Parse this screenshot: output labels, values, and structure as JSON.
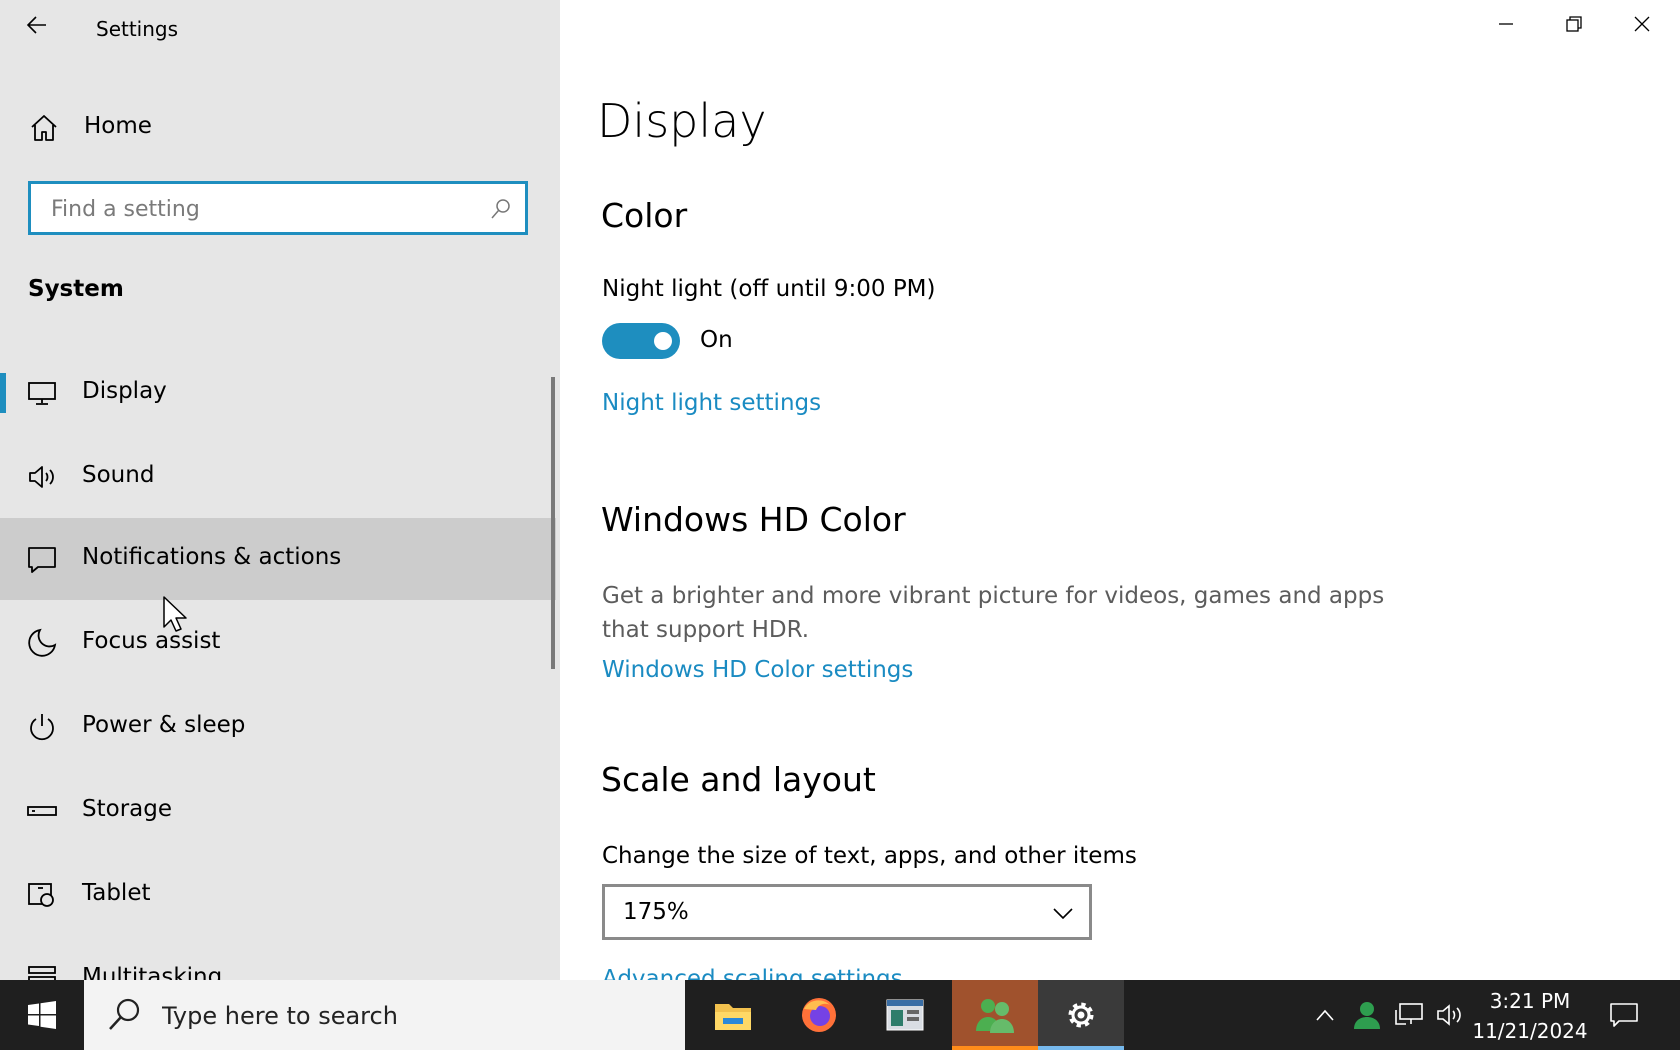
{
  "window": {
    "title": "Settings",
    "minimize_icon": "minimize-icon",
    "restore_icon": "restore-icon",
    "close_icon": "close-icon"
  },
  "sidebar": {
    "home_label": "Home",
    "search_placeholder": "Find a setting",
    "section": "System",
    "items": [
      {
        "label": "Display",
        "icon": "monitor-icon",
        "selected": true
      },
      {
        "label": "Sound",
        "icon": "speaker-icon"
      },
      {
        "label": "Notifications & actions",
        "icon": "notification-icon",
        "hover": true
      },
      {
        "label": "Focus assist",
        "icon": "moon-icon"
      },
      {
        "label": "Power & sleep",
        "icon": "power-icon"
      },
      {
        "label": "Storage",
        "icon": "storage-icon"
      },
      {
        "label": "Tablet",
        "icon": "tablet-icon"
      },
      {
        "label": "Multitasking",
        "icon": "multitasking-icon"
      }
    ]
  },
  "main": {
    "title": "Display",
    "color": {
      "heading": "Color",
      "night_light_label": "Night light (off until 9:00 PM)",
      "toggle_state": "On",
      "toggle_on": true,
      "settings_link": "Night light settings"
    },
    "hd_color": {
      "heading": "Windows HD Color",
      "description": "Get a brighter and more vibrant picture for videos, games and apps that support HDR.",
      "settings_link": "Windows HD Color settings"
    },
    "scale": {
      "heading": "Scale and layout",
      "label": "Change the size of text, apps, and other items",
      "value": "175%",
      "advanced_link": "Advanced scaling settings"
    }
  },
  "taskbar": {
    "search_placeholder": "Type here to search",
    "apps": [
      "file-explorer-icon",
      "firefox-icon",
      "app-window-icon",
      "people-app-icon",
      "settings-gear-icon"
    ],
    "time": "3:21 PM",
    "date": "11/21/2024"
  },
  "colors": {
    "accent": "#1e8ebf",
    "link": "#1a8bc2",
    "sidebar_bg": "#e6e6e6",
    "hover_bg": "#cccccc",
    "taskbar_bg": "#1f1f1f"
  }
}
